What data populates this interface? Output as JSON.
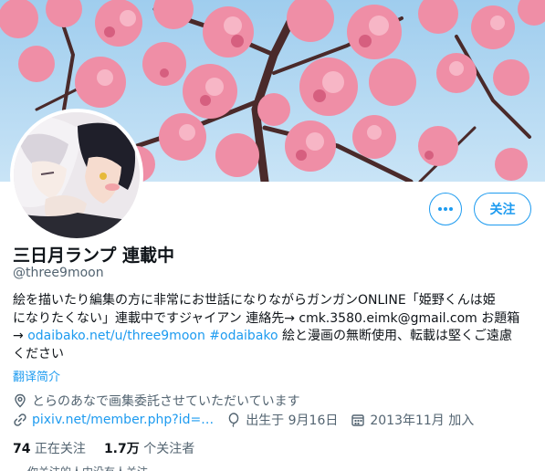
{
  "profile": {
    "display_name": "三日月ランプ 連載中",
    "handle": "@three9moon",
    "follow_label": "关注",
    "more_label": "•••"
  },
  "bio": {
    "line1": "絵を描いたり編集の方に非常にお世話になりながらガンガンONLINE「姫野くんは姫",
    "line2": "になりたくない」連載中ですジャイアン 連絡先→ cmk.3580.eimk@gmail.com お題箱",
    "line3_prefix": "→ ",
    "line3_link1": "odaibako.net/u/three9moon",
    "line3_space": " ",
    "line3_link2": "#odaibako",
    "line3_suffix": " 絵と漫画の無断使用、転載は堅くご遠慮",
    "line4": "ください"
  },
  "translate_label": "翻译简介",
  "meta": {
    "location": "とらのあなで画集委託させていただいています",
    "website": "pixiv.net/member.php?id=…",
    "birthday": "出生于 9月16日",
    "joined": "2013年11月 加入"
  },
  "stats": {
    "following_count": "74",
    "following_label": " 正在关注",
    "followers_count": "1.7万",
    "followers_label": " 个关注者"
  },
  "cutoff_text": "你关注的人中没有人关注",
  "colors": {
    "accent": "#1d9bf0",
    "secondary_text": "#536471",
    "primary_text": "#0f1419",
    "banner_sky": "#8fc4e8",
    "blossom": "#f08fa5",
    "branch": "#4a2a2a"
  },
  "icons": {
    "more": "more-icon",
    "location": "location-pin-icon",
    "website": "link-icon",
    "birthday": "balloon-icon",
    "joined": "calendar-icon"
  }
}
